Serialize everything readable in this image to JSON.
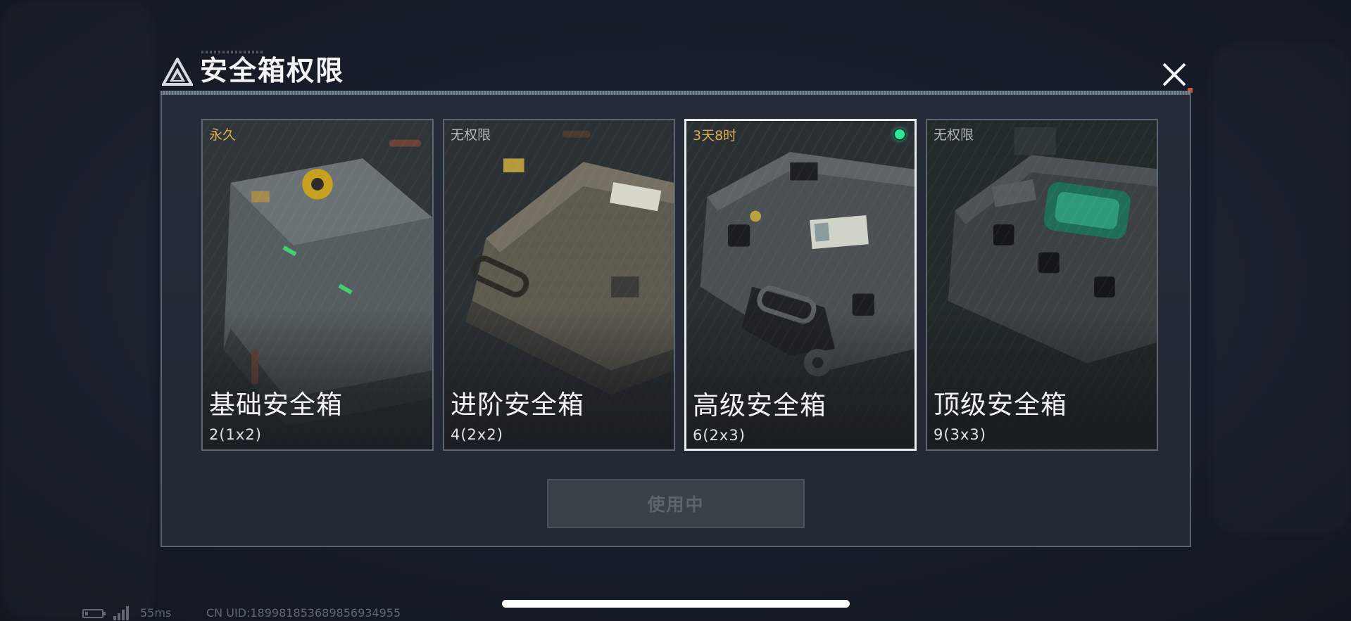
{
  "dialog": {
    "title": "安全箱权限",
    "use_button_label": "使用中"
  },
  "cards": [
    {
      "status": "永久",
      "name": "基础安全箱",
      "capacity": "2(1x2)",
      "selected": false
    },
    {
      "status": "无权限",
      "name": "进阶安全箱",
      "capacity": "4(2x2)",
      "selected": false
    },
    {
      "status": "3天8时",
      "name": "高级安全箱",
      "capacity": "6(2x3)",
      "selected": true
    },
    {
      "status": "无权限",
      "name": "顶级安全箱",
      "capacity": "9(3x3)",
      "selected": false
    }
  ],
  "footer": {
    "ping": "55ms",
    "uid": "CN UID:18998185368985693495​5"
  },
  "icons": {
    "title_logo": "triangle-logo-icon",
    "close": "close-icon",
    "active": "active-dot-icon",
    "battery": "battery-icon",
    "signal": "signal-icon"
  },
  "colors": {
    "gold_status": "#d9ad4f",
    "grey_status": "#b4b9bf",
    "active_dot": "#2de89a",
    "selected_border": "#e7ecef"
  }
}
